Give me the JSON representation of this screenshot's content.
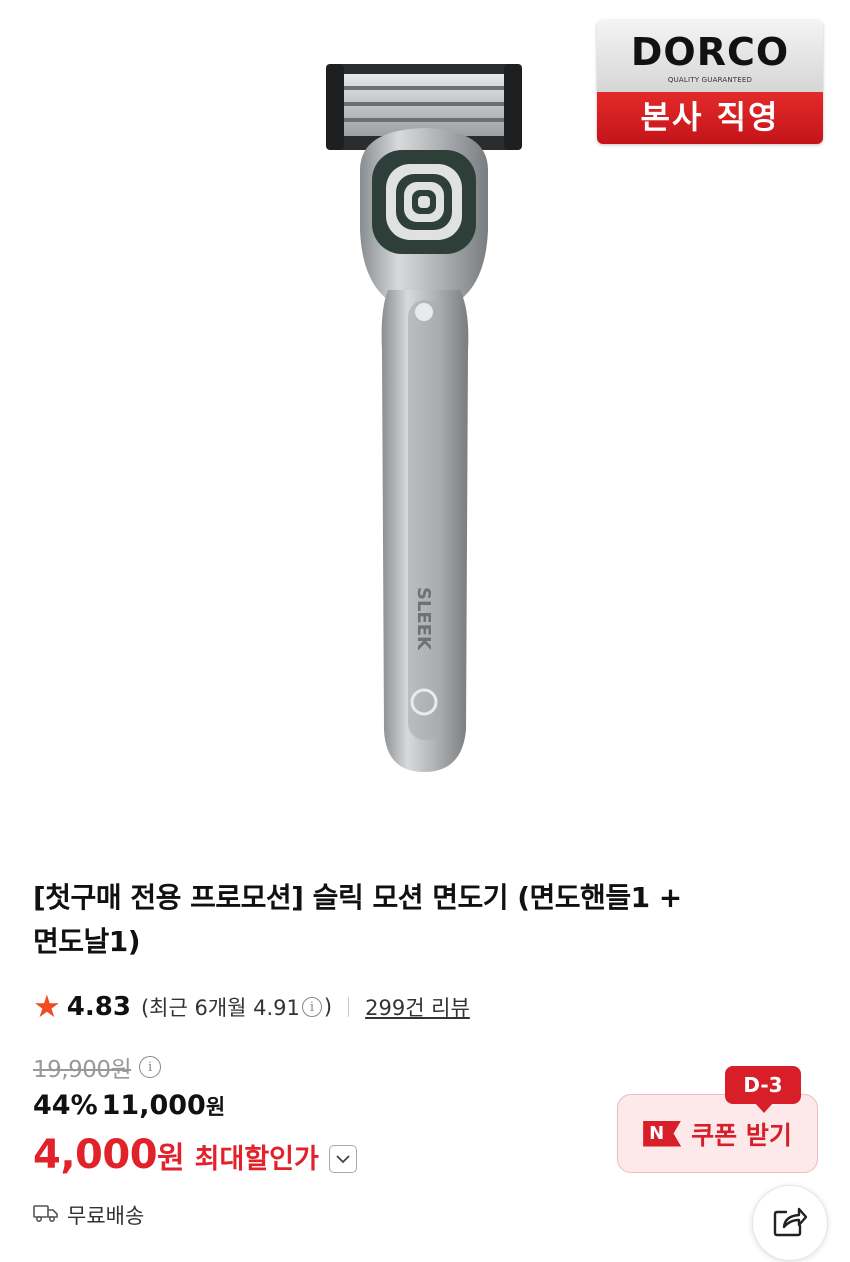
{
  "badge": {
    "brand": "DORCO",
    "tagline": "QUALITY GUARANTEED",
    "label": "본사 직영"
  },
  "product": {
    "title_line1": "[첫구매 전용 프로모션] 슬릭 모션 면도기 (면도핸들1 +",
    "title_line2": "면도날1)",
    "handle_print": "SLEEK"
  },
  "rating": {
    "score": "4.83",
    "recent_prefix": "(최근 6개월 4.91",
    "recent_suffix": ")",
    "info_icon": "info-icon",
    "reviews": "299건 리뷰",
    "star_color": "#f04b23"
  },
  "price": {
    "original": "19,900원",
    "discount_rate": "44%",
    "sale_price": "11,000",
    "currency": "원",
    "max_discount_price": "4,000",
    "max_discount_currency": "원",
    "max_discount_label": "최대할인가",
    "accent_color": "#e1222b"
  },
  "shipping": {
    "icon": "truck-icon",
    "label": "무료배송"
  },
  "coupon": {
    "dday": "D-3",
    "icon_letter": "N",
    "label": "쿠폰 받기"
  },
  "actions": {
    "share_icon": "share-icon"
  }
}
